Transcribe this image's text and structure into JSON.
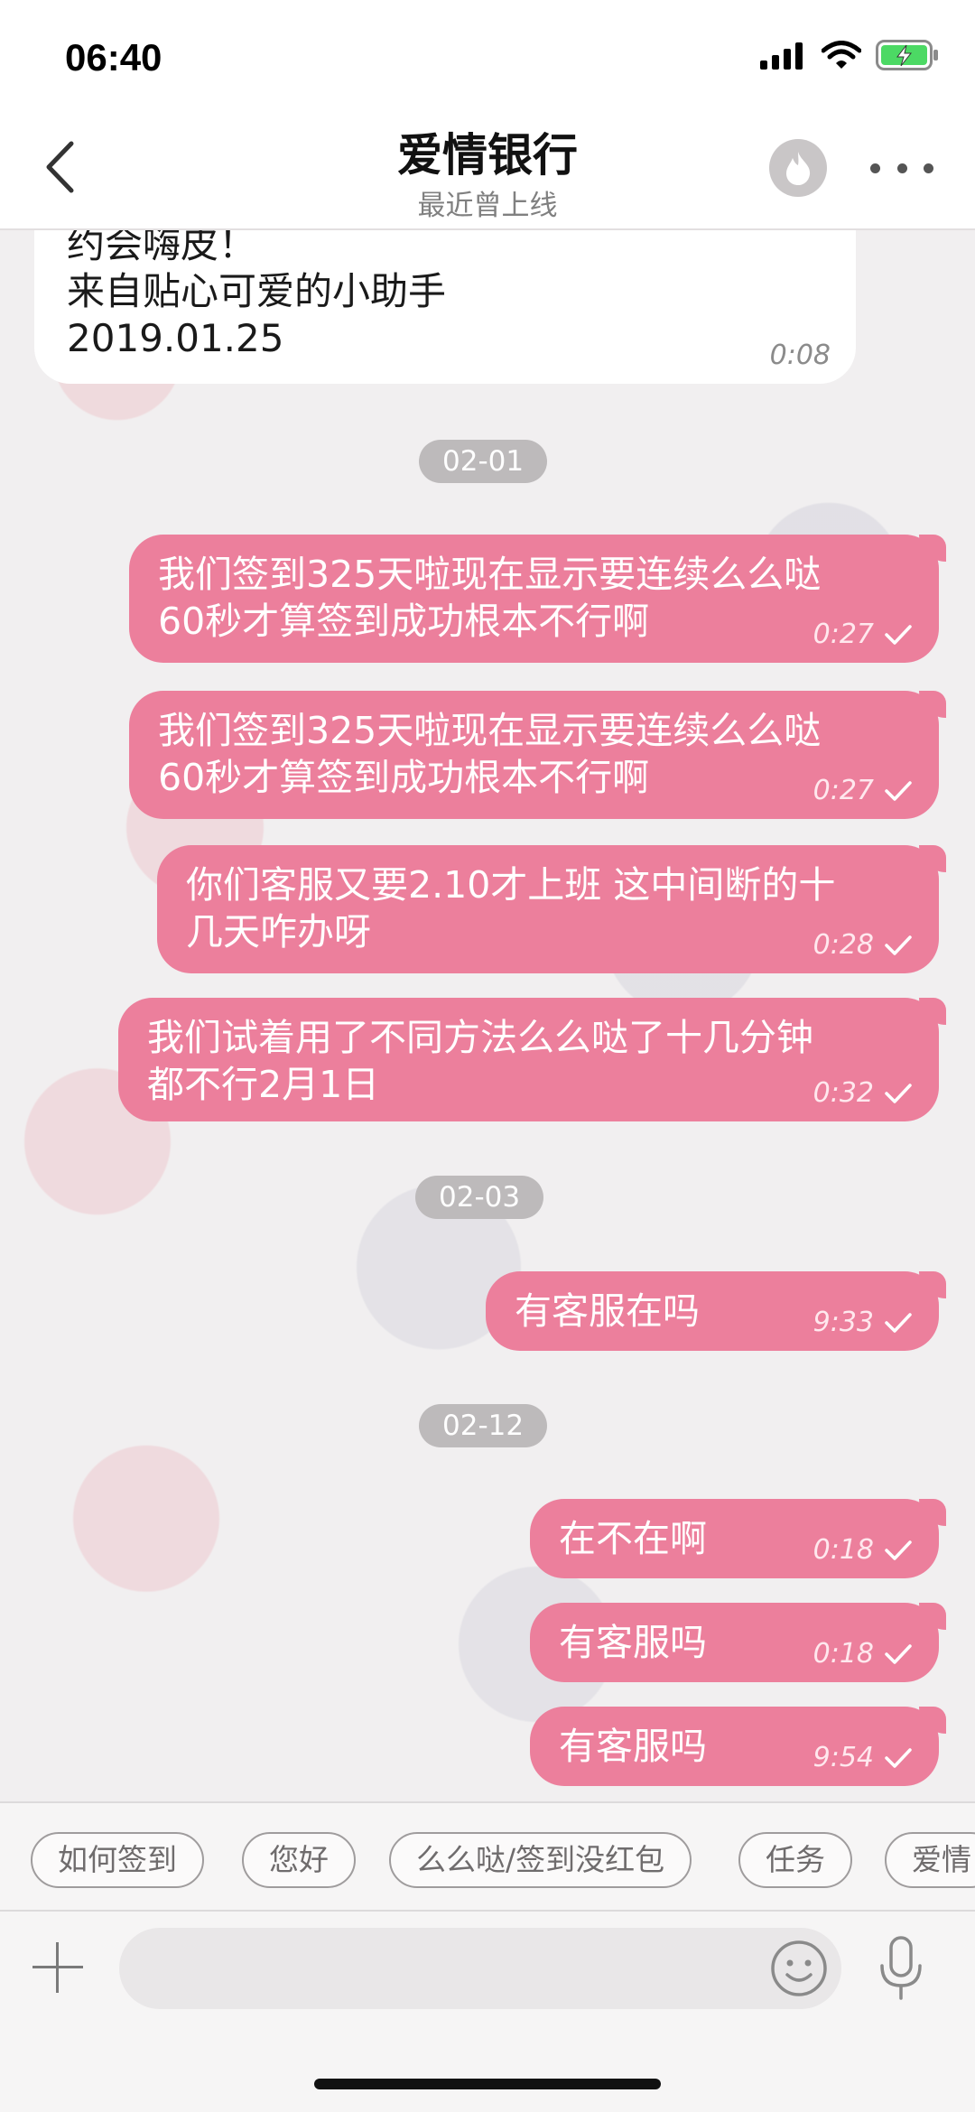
{
  "status": {
    "time": "06:40"
  },
  "header": {
    "title": "爱情银行",
    "subtitle": "最近曾上线"
  },
  "incoming": {
    "lines": [
      "约会嗨皮！",
      "来自贴心可爱的小助手",
      "2019.01.25"
    ],
    "time": "0:08"
  },
  "dates": [
    "02-01",
    "02-03",
    "02-12"
  ],
  "messages": [
    {
      "lines": [
        "我们签到325天啦现在显示要连续么么哒",
        "60秒才算签到成功根本不行啊"
      ],
      "time": "0:27"
    },
    {
      "lines": [
        "我们签到325天啦现在显示要连续么么哒",
        "60秒才算签到成功根本不行啊"
      ],
      "time": "0:27"
    },
    {
      "lines": [
        "你们客服又要2.10才上班 这中间断的十",
        "几天咋办呀"
      ],
      "time": "0:28"
    },
    {
      "lines": [
        "我们试着用了不同方法么么哒了十几分钟",
        "都不行2月1日"
      ],
      "time": "0:32"
    },
    {
      "lines": [
        "有客服在吗"
      ],
      "time": "9:33"
    },
    {
      "lines": [
        "在不在啊"
      ],
      "time": "0:18"
    },
    {
      "lines": [
        "有客服吗"
      ],
      "time": "0:18"
    },
    {
      "lines": [
        "有客服吗"
      ],
      "time": "9:54"
    }
  ],
  "quick_replies": [
    "如何签到",
    "您好",
    "么么哒/签到没红包",
    "任务",
    "爱情"
  ],
  "input": {
    "placeholder": ""
  },
  "colors": {
    "bubble_out": "#ec7f9c",
    "date_pill": "#bdbabb",
    "battery": "#4cd964"
  },
  "icons": [
    "signal-icon",
    "wifi-icon",
    "battery-charging-icon",
    "back-chevron-icon",
    "flame-icon",
    "more-dots-icon",
    "check-icon",
    "plus-icon",
    "emoji-icon",
    "mic-icon"
  ]
}
